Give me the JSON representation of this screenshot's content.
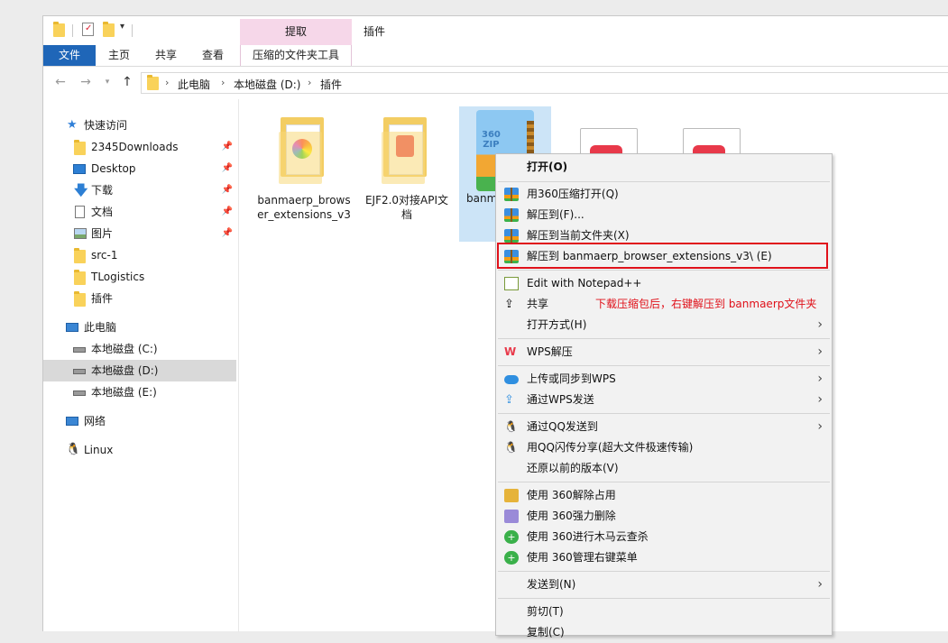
{
  "window": {
    "quick_access_dropdown": "▾",
    "ribbon_group_label": "提取",
    "manage_tab_label": "插件"
  },
  "tabs": {
    "file": "文件",
    "home": "主页",
    "share": "共享",
    "view": "查看",
    "tools": "压缩的文件夹工具"
  },
  "address": {
    "crumbs": [
      "此电脑",
      "本地磁盘 (D:)",
      "插件"
    ]
  },
  "sidebar": {
    "quick_access": "快速访问",
    "items": [
      {
        "label": "2345Downloads",
        "pinned": true
      },
      {
        "label": "Desktop",
        "pinned": true
      },
      {
        "label": "下载",
        "pinned": true
      },
      {
        "label": "文档",
        "pinned": true
      },
      {
        "label": "图片",
        "pinned": true
      },
      {
        "label": "src-1",
        "pinned": false
      },
      {
        "label": "TLogistics",
        "pinned": false
      },
      {
        "label": "插件",
        "pinned": false
      }
    ],
    "this_pc": "此电脑",
    "drives": [
      "本地磁盘 (C:)",
      "本地磁盘 (D:)",
      "本地磁盘 (E:)"
    ],
    "network": "网络",
    "linux": "Linux"
  },
  "files": [
    {
      "name": "banmaerp_browser_extensions_v3"
    },
    {
      "name": "EJF2.0对接API文档"
    },
    {
      "name": "banm wser_ s_"
    }
  ],
  "menu": {
    "items": [
      {
        "label": "打开(O)"
      },
      {
        "label": "用360压缩打开(Q)"
      },
      {
        "label": "解压到(F)..."
      },
      {
        "label": "解压到当前文件夹(X)"
      },
      {
        "label": "解压到 banmaerp_browser_extensions_v3\\ (E)"
      },
      {
        "label": "Edit with Notepad++"
      },
      {
        "label": "共享"
      },
      {
        "label": "打开方式(H)"
      },
      {
        "label": "WPS解压"
      },
      {
        "label": "上传或同步到WPS"
      },
      {
        "label": "通过WPS发送"
      },
      {
        "label": "通过QQ发送到"
      },
      {
        "label": "用QQ闪传分享(超大文件极速传输)"
      },
      {
        "label": "还原以前的版本(V)"
      },
      {
        "label": "使用 360解除占用"
      },
      {
        "label": "使用 360强力删除"
      },
      {
        "label": "使用 360进行木马云查杀"
      },
      {
        "label": "使用 360管理右键菜单"
      },
      {
        "label": "发送到(N)"
      },
      {
        "label": "剪切(T)"
      },
      {
        "label": "复制(C)"
      }
    ]
  },
  "annotation": "下载压缩包后，右键解压到 banmaerp文件夹",
  "colors": {
    "accent": "#1f66b8",
    "highlight": "#e0111a",
    "selection": "#cce4f7"
  }
}
